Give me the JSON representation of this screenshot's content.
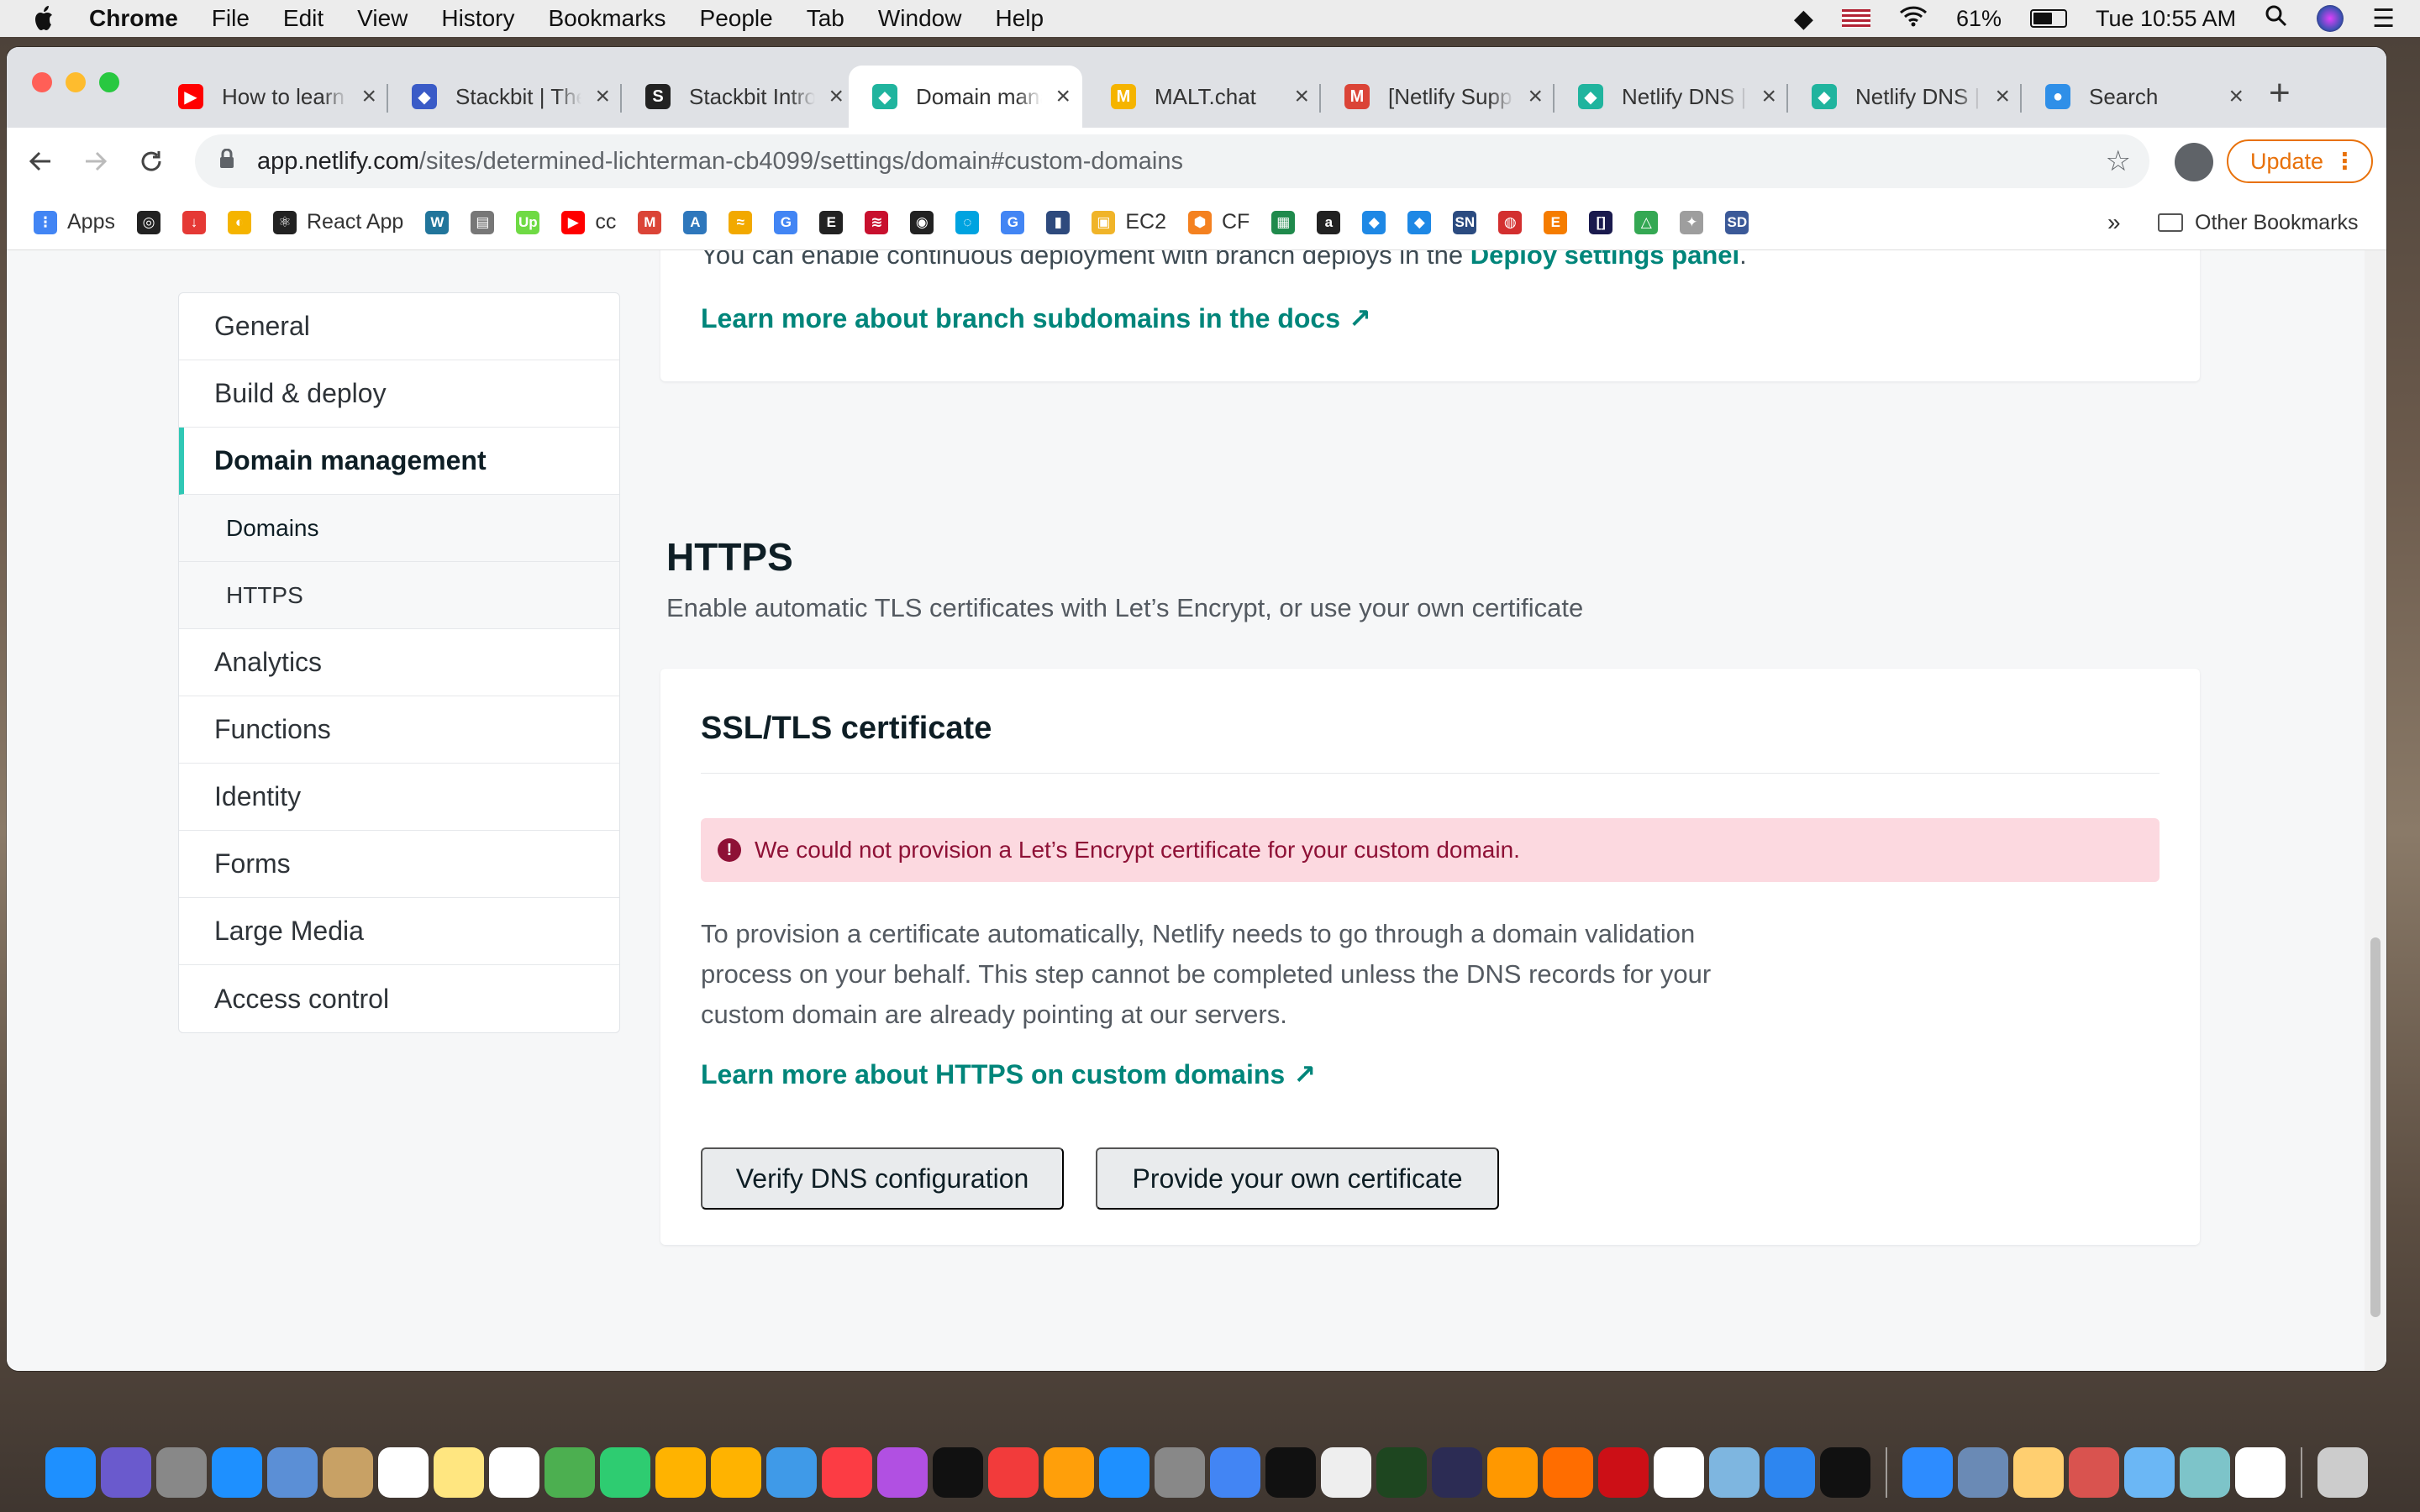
{
  "menubar": {
    "app": "Chrome",
    "items": [
      "File",
      "Edit",
      "View",
      "History",
      "Bookmarks",
      "People",
      "Tab",
      "Window",
      "Help"
    ],
    "battery": "61%",
    "clock": "Tue 10:55 AM"
  },
  "tabs": [
    {
      "title": "How to learn",
      "color": "#ff0000",
      "glyph": "▶"
    },
    {
      "title": "Stackbit | The",
      "color": "#3a5bc7",
      "glyph": "◆"
    },
    {
      "title": "Stackbit Intro",
      "color": "#222222",
      "glyph": "S"
    },
    {
      "title": "Domain mana",
      "color": "#20b49e",
      "glyph": "◆"
    },
    {
      "title": "MALT.chat",
      "color": "#f5b400",
      "glyph": "M"
    },
    {
      "title": "[Netlify Supp",
      "color": "#db4437",
      "glyph": "M"
    },
    {
      "title": "Netlify DNS |",
      "color": "#20b49e",
      "glyph": "◆"
    },
    {
      "title": "Netlify DNS |",
      "color": "#20b49e",
      "glyph": "◆"
    },
    {
      "title": "Search",
      "color": "#2f8fe8",
      "glyph": "●"
    }
  ],
  "address": {
    "host": "app.netlify.com",
    "path": "/sites/determined-lichterman-cb4099/settings/domain#custom-domains"
  },
  "update_label": "Update",
  "bookmarks": [
    {
      "label": "Apps",
      "color": "#4285f4",
      "glyph": "⋮"
    },
    {
      "label": "",
      "color": "#222222",
      "glyph": "◎"
    },
    {
      "label": "",
      "color": "#e53935",
      "glyph": "↓"
    },
    {
      "label": "",
      "color": "#f5b400",
      "glyph": "◐"
    },
    {
      "label": "React App",
      "color": "#222222",
      "glyph": "⚛"
    },
    {
      "label": "",
      "color": "#21759b",
      "glyph": "W"
    },
    {
      "label": "",
      "color": "#777777",
      "glyph": "▤"
    },
    {
      "label": "",
      "color": "#6fda44",
      "glyph": "Up"
    },
    {
      "label": "cc",
      "color": "#ff0000",
      "glyph": "▶"
    },
    {
      "label": "",
      "color": "#db4437",
      "glyph": "M"
    },
    {
      "label": "",
      "color": "#2e77bc",
      "glyph": "A"
    },
    {
      "label": "",
      "color": "#f2a900",
      "glyph": "≈"
    },
    {
      "label": "",
      "color": "#4285f4",
      "glyph": "G"
    },
    {
      "label": "",
      "color": "#222222",
      "glyph": "E"
    },
    {
      "label": "",
      "color": "#c8102e",
      "glyph": "≋"
    },
    {
      "label": "",
      "color": "#222222",
      "glyph": "◉"
    },
    {
      "label": "",
      "color": "#00a3e0",
      "glyph": "◌"
    },
    {
      "label": "",
      "color": "#4285f4",
      "glyph": "G"
    },
    {
      "label": "",
      "color": "#2e4a7d",
      "glyph": "▮"
    },
    {
      "label": "EC2",
      "color": "#f0b429",
      "glyph": "▣"
    },
    {
      "label": "CF",
      "color": "#f48120",
      "glyph": "⬢"
    },
    {
      "label": "",
      "color": "#1f8a4c",
      "glyph": "▦"
    },
    {
      "label": "",
      "color": "#222222",
      "glyph": "a"
    },
    {
      "label": "",
      "color": "#1e88e5",
      "glyph": "◆"
    },
    {
      "label": "",
      "color": "#1e88e5",
      "glyph": "◆"
    },
    {
      "label": "",
      "color": "#2b4b80",
      "glyph": "SN"
    },
    {
      "label": "",
      "color": "#d32f2f",
      "glyph": "◍"
    },
    {
      "label": "",
      "color": "#f57c00",
      "glyph": "E"
    },
    {
      "label": "",
      "color": "#1a1a4e",
      "glyph": "[]"
    },
    {
      "label": "",
      "color": "#34a853",
      "glyph": "△"
    },
    {
      "label": "",
      "color": "#9e9e9e",
      "glyph": "✦"
    },
    {
      "label": "",
      "color": "#3b5998",
      "glyph": "SD"
    }
  ],
  "other_bookmarks": "Other Bookmarks",
  "sidenav": {
    "items": [
      "General",
      "Build & deploy",
      "Domain management"
    ],
    "subitems": [
      "Domains",
      "HTTPS"
    ],
    "items2": [
      "Analytics",
      "Functions",
      "Identity",
      "Forms",
      "Large Media",
      "Access control"
    ]
  },
  "branch": {
    "text": "You can enable continuous deployment with branch deploys in the ",
    "link": "Deploy settings panel",
    "period": ".",
    "learn": "Learn more about branch subdomains in the docs"
  },
  "https": {
    "title": "HTTPS",
    "desc": "Enable automatic TLS certificates with Let’s Encrypt, or use your own certificate"
  },
  "ssl": {
    "title": "SSL/TLS certificate",
    "alert": "We could not provision a Let’s Encrypt certificate for your custom domain.",
    "para": "To provision a certificate automatically, Netlify needs to go through a domain validation process on your behalf. This step cannot be completed unless the DNS records for your custom domain are already pointing at our servers.",
    "learn": "Learn more about HTTPS on custom domains",
    "btn_verify": "Verify DNS configuration",
    "btn_own": "Provide your own certificate"
  },
  "dock_colors": [
    "#1e90ff",
    "#6a5acd",
    "#888888",
    "#1e90ff",
    "#5b8fd6",
    "#c8a165",
    "#ffffff",
    "#ffe680",
    "#ffffff",
    "#4caf50",
    "#2ecc71",
    "#ffb300",
    "#ffb300",
    "#3f9ae8",
    "#fc3c44",
    "#b150e2",
    "#111111",
    "#f23b3b",
    "#ff9f0a",
    "#1e90ff",
    "#888888",
    "#4285f4",
    "#111111",
    "#eeeeee",
    "#1e4620",
    "#2c2c54",
    "#ff9800",
    "#ff6d00",
    "#cc0f16",
    "#ffffff",
    "#7eb6e0",
    "#2d86f0",
    "#111111",
    "#2d8cff",
    "#6a8ab5",
    "#ffcf70",
    "#d9534f",
    "#6bb7f5",
    "#7dc4c9",
    "#ffffff",
    "#cccccc"
  ]
}
